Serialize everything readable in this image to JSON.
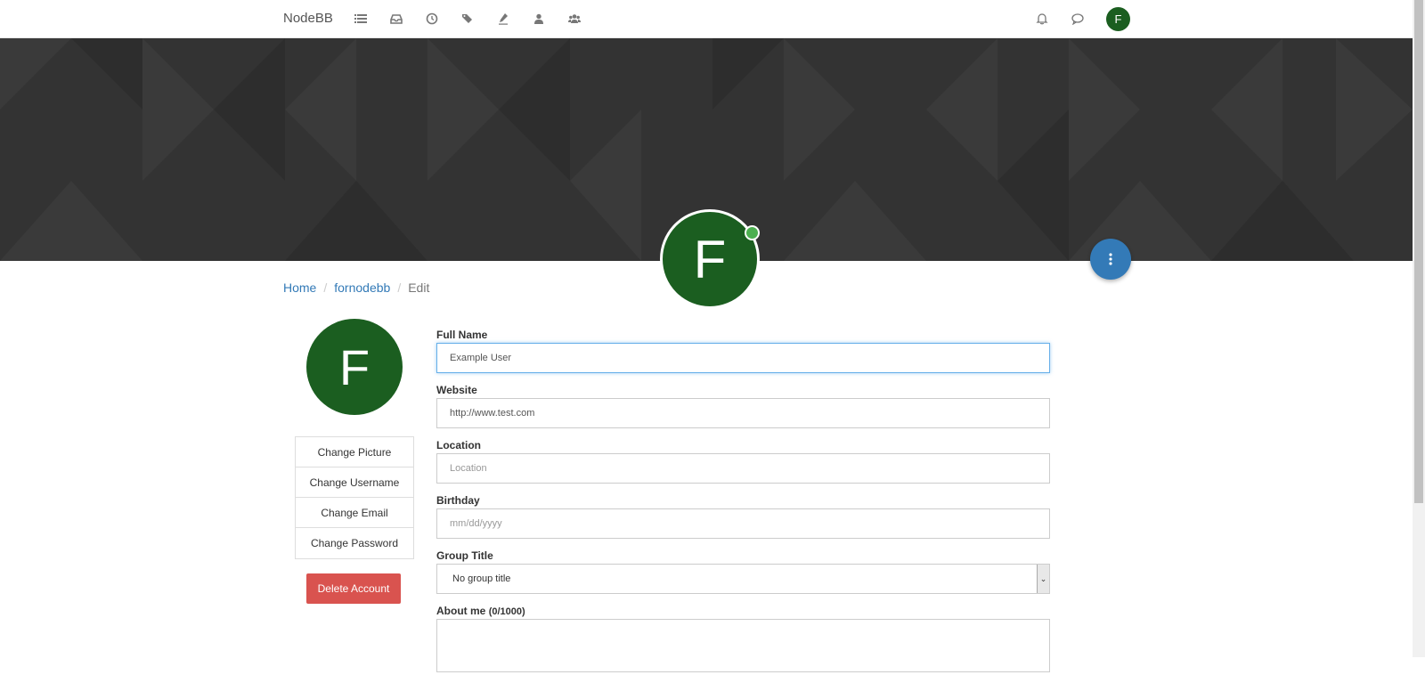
{
  "nav": {
    "brand": "NodeBB",
    "icons": [
      "list-icon",
      "inbox-icon",
      "clock-icon",
      "tags-icon",
      "pencil-icon",
      "user-icon",
      "users-icon"
    ],
    "right_icons": [
      "bell-icon",
      "chat-icon"
    ],
    "avatar_letter": "F",
    "avatar_color": "#1b5e20"
  },
  "profile": {
    "avatar_letter": "F",
    "online_color": "#4caf50",
    "fab_color": "#337ab7"
  },
  "breadcrumb": {
    "home": "Home",
    "user": "fornodebb",
    "current": "Edit"
  },
  "sidebar": {
    "avatar_letter": "F",
    "items": [
      {
        "label": "Change Picture"
      },
      {
        "label": "Change Username"
      },
      {
        "label": "Change Email"
      },
      {
        "label": "Change Password"
      }
    ],
    "delete_label": "Delete Account",
    "delete_color": "#d9534f"
  },
  "form": {
    "fullname": {
      "label": "Full Name",
      "value": "Example User"
    },
    "website": {
      "label": "Website",
      "value": "http://www.test.com"
    },
    "location": {
      "label": "Location",
      "placeholder": "Location"
    },
    "birthday": {
      "label": "Birthday",
      "placeholder": "mm/dd/yyyy"
    },
    "group_title": {
      "label": "Group Title",
      "selected": "No group title"
    },
    "about": {
      "label": "About me",
      "count": "(0/1000)"
    }
  }
}
